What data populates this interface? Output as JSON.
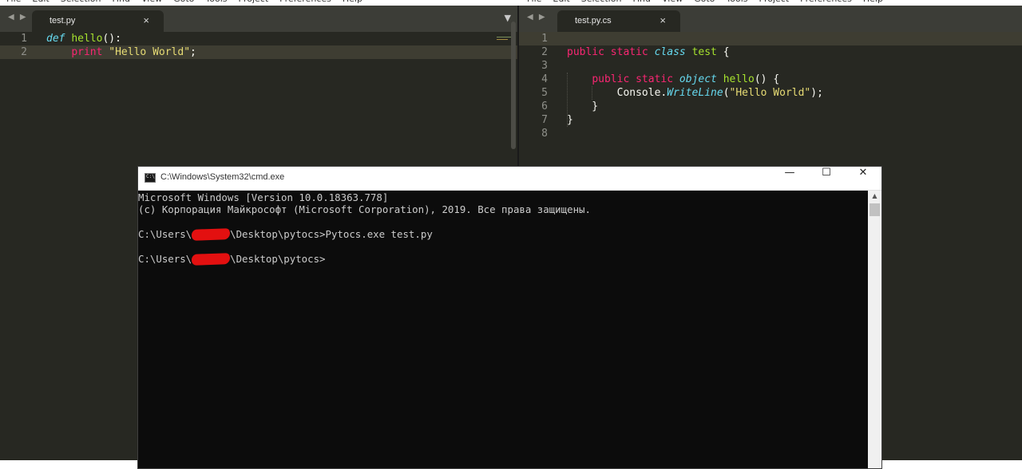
{
  "menubar_left": [
    "File",
    "Edit",
    "Selection",
    "Find",
    "View",
    "Goto",
    "Tools",
    "Project",
    "Preferences",
    "Help"
  ],
  "menubar_right": [
    "File",
    "Edit",
    "Selection",
    "Find",
    "View",
    "Goto",
    "Tools",
    "Project",
    "Preferences",
    "Help"
  ],
  "left_editor": {
    "tab_label": "test.py",
    "tab_close": "×",
    "dropdown": "▼",
    "nav": "◀ ▶",
    "line_numbers": [
      "1",
      "2"
    ],
    "current_line": "2",
    "lines": [
      {
        "tokens": [
          {
            "t": "def",
            "c": "kw-italic"
          },
          {
            "t": " ",
            "c": "plain"
          },
          {
            "t": "hello",
            "c": "fn"
          },
          {
            "t": "():",
            "c": "plain"
          }
        ]
      },
      {
        "tokens": [
          {
            "t": "    ",
            "c": "plain"
          },
          {
            "t": "print",
            "c": "kw-pink"
          },
          {
            "t": " ",
            "c": "plain"
          },
          {
            "t": "\"Hello World\"",
            "c": "str"
          },
          {
            "t": ";",
            "c": "plain"
          }
        ]
      }
    ]
  },
  "right_editor": {
    "tab_label": "test.py.cs",
    "tab_close": "×",
    "nav": "◀ ▶",
    "line_numbers": [
      "1",
      "2",
      "3",
      "4",
      "5",
      "6",
      "7",
      "8"
    ],
    "current_line": "1",
    "lines": [
      {
        "tokens": []
      },
      {
        "tokens": [
          {
            "t": "public",
            "c": "kw-pink"
          },
          {
            "t": " ",
            "c": "plain"
          },
          {
            "t": "static",
            "c": "kw-pink"
          },
          {
            "t": " ",
            "c": "plain"
          },
          {
            "t": "class",
            "c": "kw-italic"
          },
          {
            "t": " ",
            "c": "plain"
          },
          {
            "t": "test",
            "c": "fn"
          },
          {
            "t": " {",
            "c": "plain"
          }
        ]
      },
      {
        "tokens": []
      },
      {
        "tokens": [
          {
            "t": "    ",
            "c": "plain"
          },
          {
            "t": "public",
            "c": "kw-pink"
          },
          {
            "t": " ",
            "c": "plain"
          },
          {
            "t": "static",
            "c": "kw-pink"
          },
          {
            "t": " ",
            "c": "plain"
          },
          {
            "t": "object",
            "c": "kw-italic"
          },
          {
            "t": " ",
            "c": "plain"
          },
          {
            "t": "hello",
            "c": "fn"
          },
          {
            "t": "() {",
            "c": "plain"
          }
        ]
      },
      {
        "tokens": [
          {
            "t": "        Console.",
            "c": "plain"
          },
          {
            "t": "WriteLine",
            "c": "kw-italic"
          },
          {
            "t": "(",
            "c": "plain"
          },
          {
            "t": "\"Hello World\"",
            "c": "str"
          },
          {
            "t": ");",
            "c": "plain"
          }
        ]
      },
      {
        "tokens": [
          {
            "t": "    }",
            "c": "plain"
          }
        ]
      },
      {
        "tokens": [
          {
            "t": "}",
            "c": "plain"
          }
        ]
      },
      {
        "tokens": []
      }
    ]
  },
  "cmd": {
    "title": "C:\\Windows\\System32\\cmd.exe",
    "minimize": "—",
    "maximize": "☐",
    "close": "✕",
    "scroll_up": "▲",
    "lines": [
      {
        "text": "Microsoft Windows [Version 10.0.18363.778]"
      },
      {
        "text": "(c) Корпорация Майкрософт (Microsoft Corporation), 2019. Все права защищены."
      },
      {
        "text": ""
      },
      {
        "pre": "C:\\Users\\",
        "redacted": true,
        "post": "\\Desktop\\pytocs>Pytocs.exe test.py"
      },
      {
        "text": ""
      },
      {
        "pre": "C:\\Users\\",
        "redacted": true,
        "post": "\\Desktop\\pytocs>"
      }
    ]
  },
  "colors": {
    "editor_bg": "#272822",
    "tabbar_bg": "#3c3d37",
    "keyword_pink": "#f92672",
    "keyword_cyan": "#66d9ef",
    "function_green": "#a6e22e",
    "string_yellow": "#e6db74",
    "cmd_bg": "#0c0c0c",
    "cmd_text": "#cccccc",
    "redaction_red": "#e31010"
  }
}
